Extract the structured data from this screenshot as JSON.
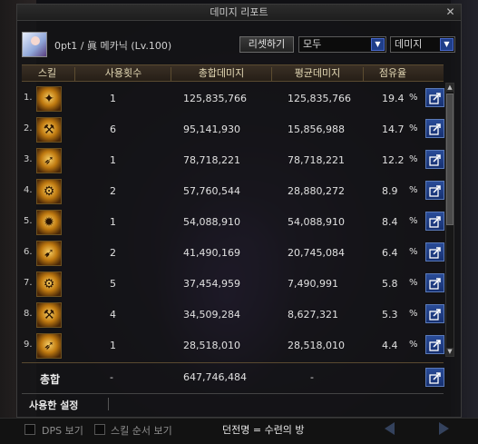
{
  "window": {
    "title": "데미지 리포트",
    "close_icon": "✕"
  },
  "character": {
    "name_label": "0pt1 / 眞 메카닉 (Lv.100)"
  },
  "controls": {
    "reset_label": "리셋하기",
    "filter_select": {
      "value": "모두"
    },
    "metric_select": {
      "value": "데미지"
    }
  },
  "table": {
    "headers": [
      "스킬",
      "사용횟수",
      "총합데미지",
      "평균데미지",
      "점유율"
    ],
    "rows": [
      {
        "num": "1.",
        "icon": "skill-icon-1",
        "count": "1",
        "total": "125,835,766",
        "avg": "125,835,766",
        "share": "19.4",
        "unit": "%"
      },
      {
        "num": "2.",
        "icon": "skill-icon-2",
        "count": "6",
        "total": "95,141,930",
        "avg": "15,856,988",
        "share": "14.7",
        "unit": "%"
      },
      {
        "num": "3.",
        "icon": "skill-icon-3",
        "count": "1",
        "total": "78,718,221",
        "avg": "78,718,221",
        "share": "12.2",
        "unit": "%"
      },
      {
        "num": "4.",
        "icon": "skill-icon-4",
        "count": "2",
        "total": "57,760,544",
        "avg": "28,880,272",
        "share": "8.9",
        "unit": "%"
      },
      {
        "num": "5.",
        "icon": "skill-icon-5",
        "count": "1",
        "total": "54,088,910",
        "avg": "54,088,910",
        "share": "8.4",
        "unit": "%"
      },
      {
        "num": "6.",
        "icon": "skill-icon-6",
        "count": "2",
        "total": "41,490,169",
        "avg": "20,745,084",
        "share": "6.4",
        "unit": "%"
      },
      {
        "num": "7.",
        "icon": "skill-icon-7",
        "count": "5",
        "total": "37,454,959",
        "avg": "7,490,991",
        "share": "5.8",
        "unit": "%"
      },
      {
        "num": "8.",
        "icon": "skill-icon-8",
        "count": "4",
        "total": "34,509,284",
        "avg": "8,627,321",
        "share": "5.3",
        "unit": "%"
      },
      {
        "num": "9.",
        "icon": "skill-icon-9",
        "count": "1",
        "total": "28,518,010",
        "avg": "28,518,010",
        "share": "4.4",
        "unit": "%"
      }
    ],
    "total": {
      "label": "총합",
      "count": "-",
      "total": "647,746,484",
      "avg": "-"
    }
  },
  "footer": {
    "used_settings_label": "사용한 설정",
    "dps_label": "DPS 보기",
    "skill_order_label": "스킬 순서 보기",
    "dungeon_label": "던전명 = 수련의 방"
  },
  "colors": {
    "accent": "#1f3e8a",
    "header_text": "#e4d9b5",
    "skill_icon": "#c07a10"
  }
}
